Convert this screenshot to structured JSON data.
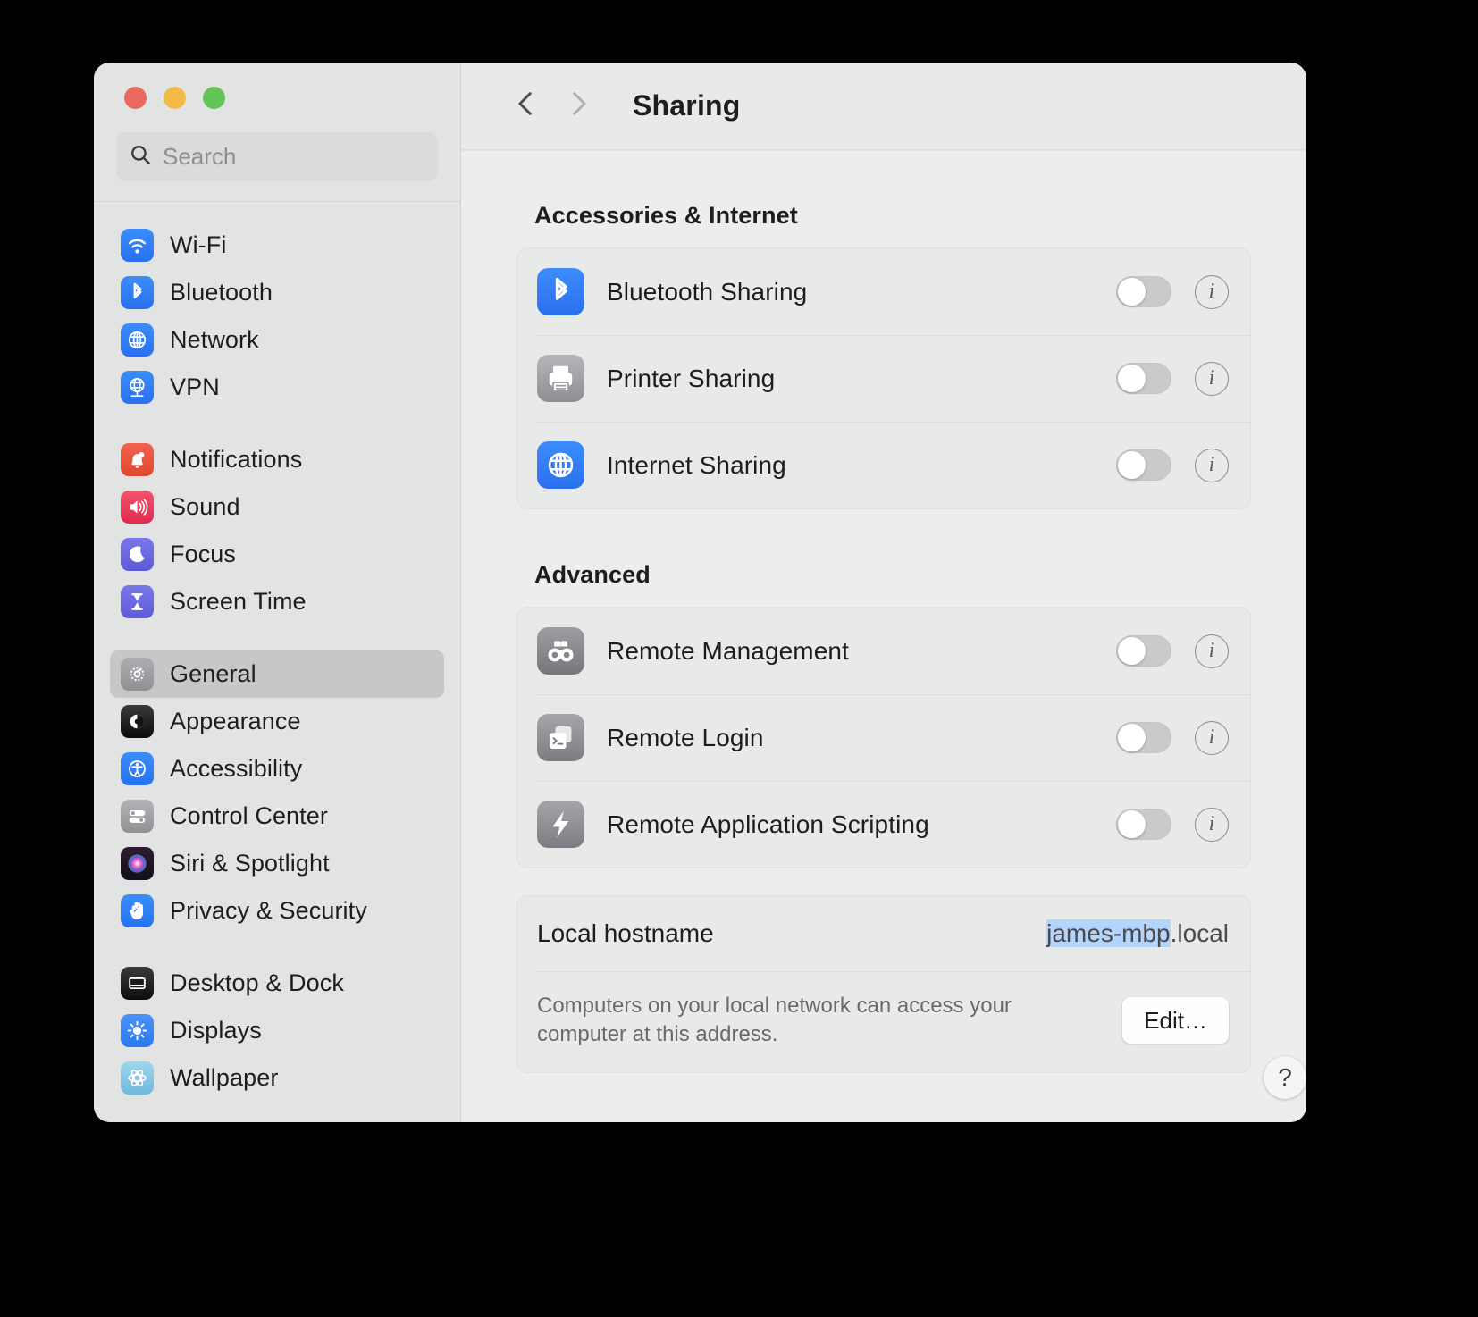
{
  "window": {
    "traffic_lights": [
      {
        "name": "close",
        "color": "#e8695e"
      },
      {
        "name": "minimize",
        "color": "#f2bb48"
      },
      {
        "name": "maximize",
        "color": "#62c456"
      }
    ]
  },
  "search": {
    "placeholder": "Search",
    "value": "",
    "icon": "search-icon"
  },
  "sidebar": {
    "groups": [
      {
        "items": [
          {
            "label": "Wi-Fi",
            "icon": "wifi-icon",
            "selected": false
          },
          {
            "label": "Bluetooth",
            "icon": "bluetooth-icon",
            "selected": false
          },
          {
            "label": "Network",
            "icon": "globe-icon",
            "selected": false
          },
          {
            "label": "VPN",
            "icon": "vpn-globe-icon",
            "selected": false
          }
        ]
      },
      {
        "items": [
          {
            "label": "Notifications",
            "icon": "bell-icon",
            "selected": false
          },
          {
            "label": "Sound",
            "icon": "speaker-icon",
            "selected": false
          },
          {
            "label": "Focus",
            "icon": "moon-icon",
            "selected": false
          },
          {
            "label": "Screen Time",
            "icon": "hourglass-icon",
            "selected": false
          }
        ]
      },
      {
        "items": [
          {
            "label": "General",
            "icon": "gear-icon",
            "selected": true
          },
          {
            "label": "Appearance",
            "icon": "appearance-icon",
            "selected": false
          },
          {
            "label": "Accessibility",
            "icon": "accessibility-icon",
            "selected": false
          },
          {
            "label": "Control Center",
            "icon": "control-center-icon",
            "selected": false
          },
          {
            "label": "Siri & Spotlight",
            "icon": "siri-icon",
            "selected": false
          },
          {
            "label": "Privacy & Security",
            "icon": "hand-icon",
            "selected": false
          }
        ]
      },
      {
        "items": [
          {
            "label": "Desktop & Dock",
            "icon": "desktop-dock-icon",
            "selected": false
          },
          {
            "label": "Displays",
            "icon": "brightness-icon",
            "selected": false
          },
          {
            "label": "Wallpaper",
            "icon": "wallpaper-icon",
            "selected": false
          }
        ]
      }
    ]
  },
  "toolbar": {
    "title": "Sharing",
    "back_icon": "chevron-left-icon",
    "forward_icon": "chevron-right-icon",
    "back_enabled": true,
    "forward_enabled": false
  },
  "sections": [
    {
      "title": "Accessories & Internet",
      "rows": [
        {
          "label": "Bluetooth Sharing",
          "icon": "bluetooth-icon",
          "toggle": "off",
          "info": "i"
        },
        {
          "label": "Printer Sharing",
          "icon": "printer-icon",
          "toggle": "off",
          "info": "i"
        },
        {
          "label": "Internet Sharing",
          "icon": "globe-icon",
          "toggle": "off",
          "info": "i"
        }
      ]
    },
    {
      "title": "Advanced",
      "rows": [
        {
          "label": "Remote Management",
          "icon": "binoculars-icon",
          "toggle": "off",
          "info": "i"
        },
        {
          "label": "Remote Login",
          "icon": "terminal-icon",
          "toggle": "off",
          "info": "i"
        },
        {
          "label": "Remote Application Scripting",
          "icon": "script-icon",
          "toggle": "off",
          "info": "i"
        }
      ]
    }
  ],
  "hostname": {
    "label": "Local hostname",
    "value_selected": "james-mbp",
    "value_rest": ".local",
    "description": "Computers on your local network can access your computer at this address.",
    "edit_label": "Edit…"
  },
  "help": {
    "label": "?"
  },
  "colors": {
    "accent_blue": "#1b7ef4",
    "selection_blue": "#b3d4fd",
    "sidebar_bg": "#e2e3e3",
    "panel_bg": "#eceded",
    "card_bg": "#e8eaea",
    "selected_item_bg": "#c6c7c7"
  }
}
